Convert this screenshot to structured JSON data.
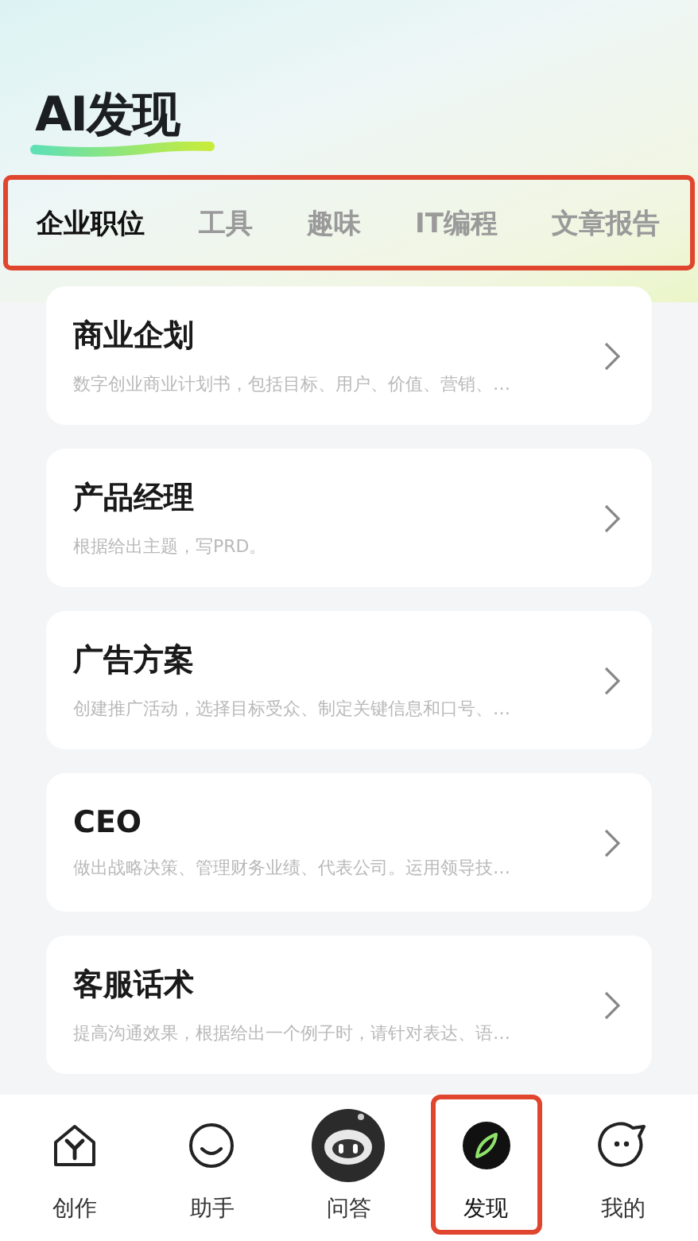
{
  "header": {
    "title": "AI发现"
  },
  "tab_bar": {
    "highlighted": true,
    "tabs": [
      {
        "label": "企业职位",
        "selected": true
      },
      {
        "label": "工具",
        "selected": false
      },
      {
        "label": "趣味",
        "selected": false
      },
      {
        "label": "IT编程",
        "selected": false
      },
      {
        "label": "文章报告",
        "selected": false
      }
    ]
  },
  "cards": [
    {
      "title": "商业企划",
      "description": "数字创业商业计划书，包括目标、用户、价值、营销、…"
    },
    {
      "title": "产品经理",
      "description": "根据给出主题，写PRD。"
    },
    {
      "title": "广告方案",
      "description": "创建推广活动，选择目标受众、制定关键信息和口号、…"
    },
    {
      "title": "CEO",
      "description": "做出战略决策、管理财务业绩、代表公司。运用领导技…"
    },
    {
      "title": "客服话术",
      "description": "提高沟通效果，根据给出一个例子时，请针对表达、语…"
    }
  ],
  "bottom_nav": [
    {
      "label": "创作",
      "kind": "create",
      "selected": false,
      "highlighted": false
    },
    {
      "label": "助手",
      "kind": "assistant",
      "selected": false,
      "highlighted": false
    },
    {
      "label": "问答",
      "kind": "robot",
      "selected": false,
      "highlighted": false
    },
    {
      "label": "发现",
      "kind": "discover",
      "selected": true,
      "highlighted": true
    },
    {
      "label": "我的",
      "kind": "me",
      "selected": false,
      "highlighted": false
    }
  ]
}
